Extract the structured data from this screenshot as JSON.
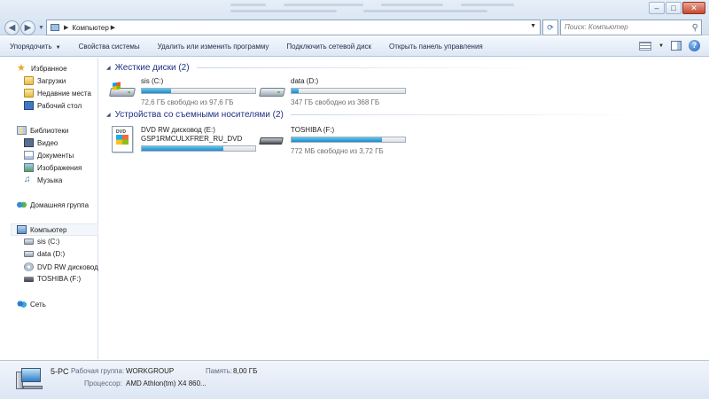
{
  "address": {
    "crumb": "Компьютер",
    "search_placeholder": "Поиск: Компьютер"
  },
  "toolbar": {
    "organize": "Упорядочить",
    "system_props": "Свойства системы",
    "uninstall": "Удалить или изменить программу",
    "map_drive": "Подключить сетевой диск",
    "control_panel": "Открыть панель управления"
  },
  "nav": {
    "favorites": "Избранное",
    "downloads": "Загрузки",
    "recent": "Недавние места",
    "desktop": "Рабочий стол",
    "libraries": "Библиотеки",
    "video": "Видео",
    "documents": "Документы",
    "images": "Изображения",
    "music": "Музыка",
    "homegroup": "Домашняя группа",
    "computer": "Компьютер",
    "drive_c": "sis (C:)",
    "drive_d": "data (D:)",
    "drive_e": "DVD RW дисковод (",
    "drive_f": "TOSHIBA (F:)",
    "network": "Сеть"
  },
  "groups": {
    "hdd": "Жесткие диски (2)",
    "removable": "Устройства со съемными носителями (2)"
  },
  "drives": {
    "c": {
      "name": "sis (C:)",
      "free": "72,6 ГБ свободно из 97,6 ГБ",
      "used_fraction": 0.26
    },
    "d": {
      "name": "data (D:)",
      "free": "347 ГБ свободно из 368 ГБ",
      "used_fraction": 0.06
    },
    "e": {
      "name": "DVD RW дисковод (E:)",
      "label": "GSP1RMCULXFRER_RU_DVD",
      "used_fraction": 0.72,
      "box_text": "DVD"
    },
    "f": {
      "name": "TOSHIBA (F:)",
      "free": "772 МБ свободно из 3,72 ГБ",
      "used_fraction": 0.8
    }
  },
  "details": {
    "name": "5-PC",
    "workgroup_label": "Рабочая группа:",
    "workgroup": "WORKGROUP",
    "memory_label": "Память:",
    "memory": "8,00 ГБ",
    "cpu_label": "Процессор:",
    "cpu": "AMD Athlon(tm) X4 860..."
  }
}
